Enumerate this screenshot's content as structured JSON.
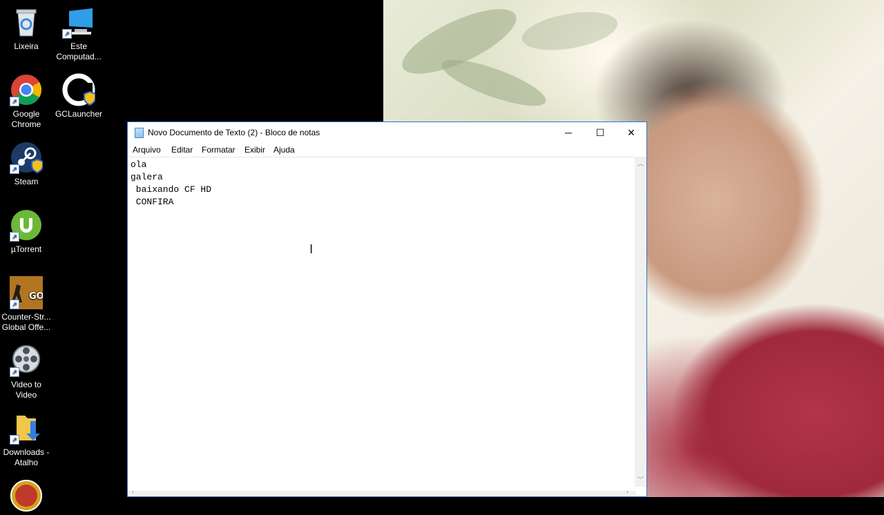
{
  "desktop": {
    "icons": [
      {
        "label": "Lixeira"
      },
      {
        "label": "Este\nComputad..."
      },
      {
        "label": "Google\nChrome"
      },
      {
        "label": "GCLauncher"
      },
      {
        "label": "Steam"
      },
      {
        "label": "µTorrent"
      },
      {
        "label": "Counter-Str...\nGlobal Offe..."
      },
      {
        "label": "Video to\nVideo"
      },
      {
        "label": "Downloads -\nAtalho"
      }
    ]
  },
  "notepad": {
    "title": "Novo Documento de Texto (2) - Bloco de notas",
    "menu": [
      "Arquivo",
      "Editar",
      "Formatar",
      "Exibir",
      "Ajuda"
    ],
    "content": "ola\ngalera\n baixando CF HD\n CONFIRA",
    "controls": {
      "minimize": "─",
      "maximize": "☐",
      "close": "✕"
    }
  },
  "icon_names": [
    "recycle-bin-icon",
    "this-pc-icon",
    "chrome-icon",
    "gclauncher-icon",
    "steam-icon",
    "utorrent-icon",
    "csgo-icon",
    "video-to-video-icon",
    "downloads-folder-icon",
    "notepad-icon",
    "text-cursor-icon"
  ]
}
